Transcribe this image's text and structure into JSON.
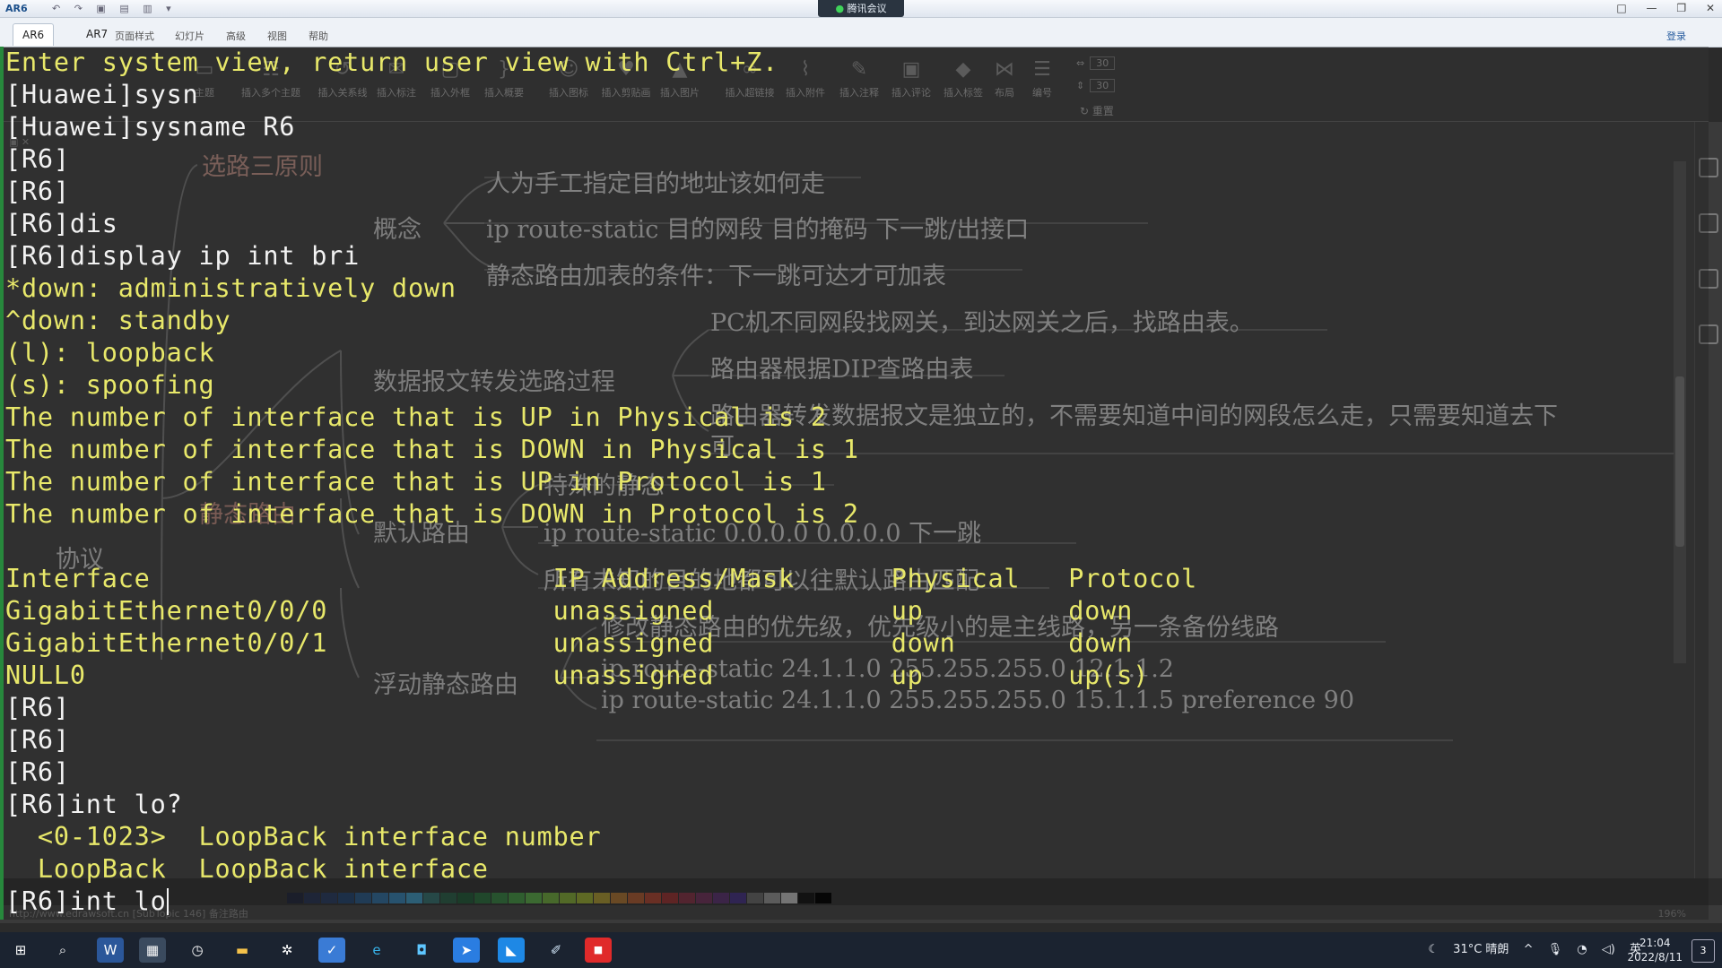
{
  "window": {
    "app_label": "AR6",
    "meeting_label": "腾讯会议",
    "controls": [
      "□",
      "—",
      "❐",
      "✕"
    ]
  },
  "tabs": [
    "AR6",
    "AR7"
  ],
  "menu": [
    "页面样式",
    "幻灯片",
    "高级",
    "视图",
    "帮助"
  ],
  "header_right": "登录",
  "ribbon": {
    "items": [
      "主题",
      "插入多个主题",
      "插入关系线",
      "插入标注",
      "插入外框",
      "插入概要",
      "插入图标",
      "插入剪贴画",
      "插入图片",
      "插入超链接",
      "插入附件",
      "插入注释",
      "插入评论",
      "插入标签",
      "布局",
      "编号"
    ],
    "spin1": "30",
    "spin2": "30",
    "reset": "重置"
  },
  "mindmap": {
    "root": "选路三原则",
    "concept": "概念",
    "c1": "人为手工指定目的地址该如何走",
    "c2": "ip route-static 目的网段 目的掩码 下一跳/出接口",
    "c3": "静态路由加表的条件：下一跳可达才可加表",
    "forwarding": "数据报文转发选路过程",
    "f1": "PC机不同网段找网关，到达网关之后，找路由表。",
    "f2": "路由器根据DIP查路由表",
    "f3": "路由器转发数据报文是独立的，不需要知道中间的网段怎么走，只需要知道去下",
    "f3b": "可",
    "special": "特殊的静态",
    "static_route": "静态路由",
    "default_route": "默认路由",
    "d1": "ip route-static 0.0.0.0 0.0.0.0 下一跳",
    "d2": "所有未知的目的地都可以往默认路由匹配",
    "protocol": "协议",
    "floating": "浮动静态路由",
    "fl1": "修改静态路由的优先级，优先级小的是主线路，另一条备份线路",
    "fl2": "ip route-static 24.1.1.0 255.255.255.0 12.1.1.2",
    "fl3": "ip route-static 24.1.1.0 255.255.255.0 15.1.1.5 preference 90"
  },
  "terminal": {
    "lines": [
      {
        "t": "Enter system view, return user view with Ctrl+Z.",
        "c": "y"
      },
      {
        "t": "[Huawei]sysn",
        "c": "w"
      },
      {
        "t": "[Huawei]sysname R6",
        "c": "w"
      },
      {
        "t": "[R6]",
        "c": "w"
      },
      {
        "t": "[R6]",
        "c": "w"
      },
      {
        "t": "[R6]dis",
        "c": "w"
      },
      {
        "t": "[R6]display ip int bri",
        "c": "w"
      },
      {
        "t": "*down: administratively down",
        "c": "y"
      },
      {
        "t": "^down: standby",
        "c": "y"
      },
      {
        "t": "(l): loopback",
        "c": "y"
      },
      {
        "t": "(s): spoofing",
        "c": "y"
      },
      {
        "t": "The number of interface that is UP in Physical is 2",
        "c": "y"
      },
      {
        "t": "The number of interface that is DOWN in Physical is 1",
        "c": "y"
      },
      {
        "t": "The number of interface that is UP in Protocol is 1",
        "c": "y"
      },
      {
        "t": "The number of interface that is DOWN in Protocol is 2",
        "c": "y"
      },
      {
        "t": "",
        "c": "w"
      },
      {
        "t": "Interface                         IP Address/Mask      Physical   Protocol",
        "c": "y"
      },
      {
        "t": "GigabitEthernet0/0/0              unassigned           up         down",
        "c": "y"
      },
      {
        "t": "GigabitEthernet0/0/1              unassigned           down       down",
        "c": "y"
      },
      {
        "t": "NULL0                             unassigned           up         up(s)",
        "c": "y"
      },
      {
        "t": "[R6]",
        "c": "w"
      },
      {
        "t": "[R6]",
        "c": "w"
      },
      {
        "t": "[R6]",
        "c": "w"
      },
      {
        "t": "[R6]int lo?",
        "c": "w"
      },
      {
        "t": "  <0-1023>  LoopBack interface number",
        "c": "y"
      },
      {
        "t": "  LoopBack  LoopBack interface",
        "c": "y"
      },
      {
        "t": "[R6]int lo",
        "c": "w"
      }
    ]
  },
  "status": {
    "left": "http://www.edrawsoft.cn  [SubTopic 146]  备注路由",
    "zoom": "196%"
  },
  "taskbar": {
    "weather": "31°C 晴朗",
    "ime": "英",
    "time": "21:04",
    "date": "2022/8/11",
    "notifications": "3"
  }
}
